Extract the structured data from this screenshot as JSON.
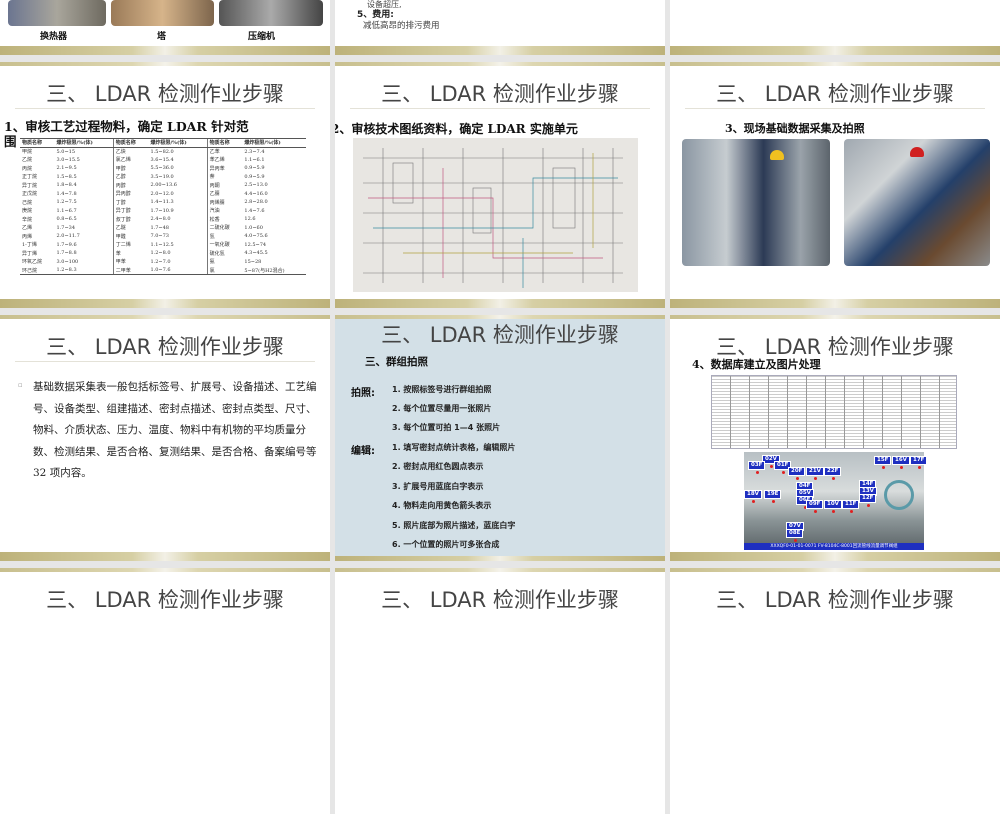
{
  "slide_title": "三、 LDAR 检测作业步骤",
  "row0": {
    "s1": {
      "captions": [
        "换热器",
        "塔",
        "压缩机"
      ]
    },
    "s2": {
      "line_partial": "设备超压,",
      "item5_head": "5、费用:",
      "item5_text": "减低高昂的排污费用"
    }
  },
  "row1": {
    "s1": {
      "subtitle": "1、审核工艺过程物料，确定 LDAR 针对范围",
      "table": {
        "headers": [
          "物质名称",
          "爆炸极限/%(体)",
          "物质名称",
          "爆炸极限/%(体)",
          "物质名称",
          "爆炸极限/%(体)"
        ],
        "rows": [
          [
            "甲烷",
            "5.0~15",
            "乙炔",
            "1.5~82.0",
            "乙苯",
            "2.3~7.4"
          ],
          [
            "乙烷",
            "3.0~15.5",
            "氯乙烯",
            "3.6~15.4",
            "苯乙烯",
            "1.1~6.1"
          ],
          [
            "丙烷",
            "2.1~9.5",
            "甲醇",
            "5.5~36.0",
            "异丙苯",
            "0.9~5.9"
          ],
          [
            "正丁烷",
            "1.5~8.5",
            "乙醇",
            "3.5~19.0",
            "萘",
            "0.9~5.9"
          ],
          [
            "异丁烷",
            "1.8~8.4",
            "丙醇",
            "2.00~13.6",
            "丙酮",
            "2.5~13.0"
          ],
          [
            "正戊烷",
            "1.4~7.8",
            "异丙醇",
            "2.0~12.0",
            "乙腈",
            "4.4~16.0"
          ],
          [
            "己烷",
            "1.2~7.5",
            "丁醇",
            "1.4~11.3",
            "丙烯腈",
            "2.8~28.0"
          ],
          [
            "庚烷",
            "1.1~6.7",
            "异丁醇",
            "1.7~10.9",
            "汽油",
            "1.4~7.6"
          ],
          [
            "辛烷",
            "0.8~6.5",
            "叔丁醇",
            "2.4~8.0",
            "松香",
            "12.6"
          ],
          [
            "乙烯",
            "1.7~34",
            "乙醚",
            "1.7~48",
            "二硫化碳",
            "1.0~60"
          ],
          [
            "丙烯",
            "2.0~11.7",
            "甲醛",
            "7.0~73",
            "氢",
            "4.0~75.6"
          ],
          [
            "1-丁烯",
            "1.7~9.6",
            "丁二烯",
            "1.1~12.5",
            "一氧化碳",
            "12.5~74"
          ],
          [
            "异丁烯",
            "1.7~8.8",
            "苯",
            "1.2~8.0",
            "硫化氢",
            "4.3~45.5"
          ],
          [
            "环氧乙烷",
            "3.0~100",
            "甲苯",
            "1.2~7.0",
            "氨",
            "15~28"
          ],
          [
            "环己烷",
            "1.2~8.3",
            "二甲苯",
            "1.0~7.6",
            "氯",
            "5~87(与H2混合)"
          ]
        ]
      }
    },
    "s2": {
      "subtitle": "2、审核技术图纸资料，确定 LDAR 实施单元"
    },
    "s3": {
      "subtitle": "3、现场基础数据采集及拍照"
    }
  },
  "row2": {
    "s1": {
      "paragraph": "基础数据采集表一般包括标签号、扩展号、设备描述、工艺编号、设备类型、组建描述、密封点描述、密封点类型、尺寸、物料、介质状态、压力、温度、物料中有机物的平均质量分数、检测结果、是否合格、复测结果、是否合格、备案编号等 32 项内容。"
    },
    "s2": {
      "subtitle": "三、群组拍照",
      "label_photo": "拍照:",
      "label_edit": "编辑:",
      "photo_steps": [
        "1. 按照标签号进行群组拍照",
        "2. 每个位置尽量用一张照片",
        "3. 每个位置可拍 1—4 张照片"
      ],
      "edit_steps": [
        "1. 填写密封点统计表格，编辑照片",
        "2. 密封点用红色圆点表示",
        "3. 扩展号用蓝底白字表示",
        "4. 物料走向用黄色箭头表示",
        "5. 照片底部为照片描述，蓝底白字",
        "6. 一个位置的照片可多张合成"
      ]
    },
    "s3": {
      "subtitle": "4、数据库建立及图片处理",
      "tags": [
        "02V",
        "03F",
        "01F",
        "20F",
        "21V",
        "22F",
        "15F",
        "16V",
        "17F",
        "04F",
        "05V",
        "06F",
        "14F",
        "13V",
        "12F",
        "18V",
        "19E",
        "09F",
        "10V",
        "11F",
        "07V",
        "08E"
      ],
      "photo_caption": "XXXQF0-01-01-0071 FV-8104C-8001回流管线流量调节阀组"
    }
  }
}
